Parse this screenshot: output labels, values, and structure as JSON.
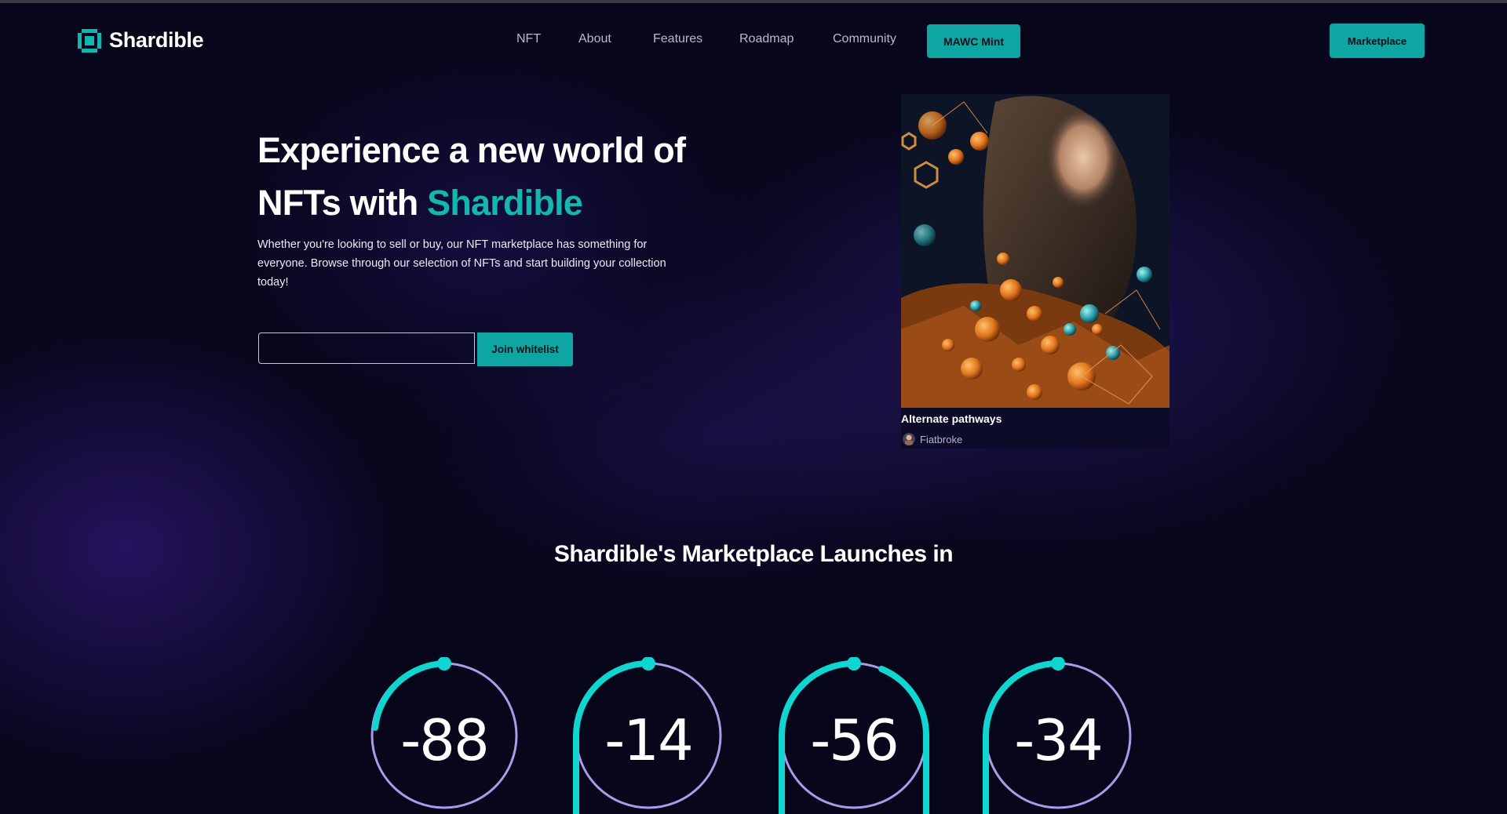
{
  "brand": {
    "name": "Shardible"
  },
  "nav": {
    "items": [
      "NFT",
      "About",
      "Features",
      "Roadmap",
      "Community"
    ],
    "mint_label": "MAWC Mint",
    "marketplace_label": "Marketplace"
  },
  "hero": {
    "title_line1": "Experience a new world of",
    "title_prefix": "NFTs with ",
    "title_accent": "Shardible",
    "description": "Whether you're looking to sell or buy, our NFT marketplace has something for everyone. Browse through our selection of NFTs and start building your collection today!",
    "whitelist_placeholder": "",
    "whitelist_button": "Join whitelist"
  },
  "nft_card": {
    "title": "Alternate pathways",
    "author": "Fiatbroke"
  },
  "countdown": {
    "title": "Shardible's Marketplace Launches in",
    "values": [
      "-88",
      "-14",
      "-56",
      "-34"
    ]
  },
  "colors": {
    "accent": "#12b8b0",
    "button": "#0ea5a3",
    "background": "#07061a",
    "ring_track": "#a69ee8",
    "ring_progress": "#10d6d2"
  }
}
